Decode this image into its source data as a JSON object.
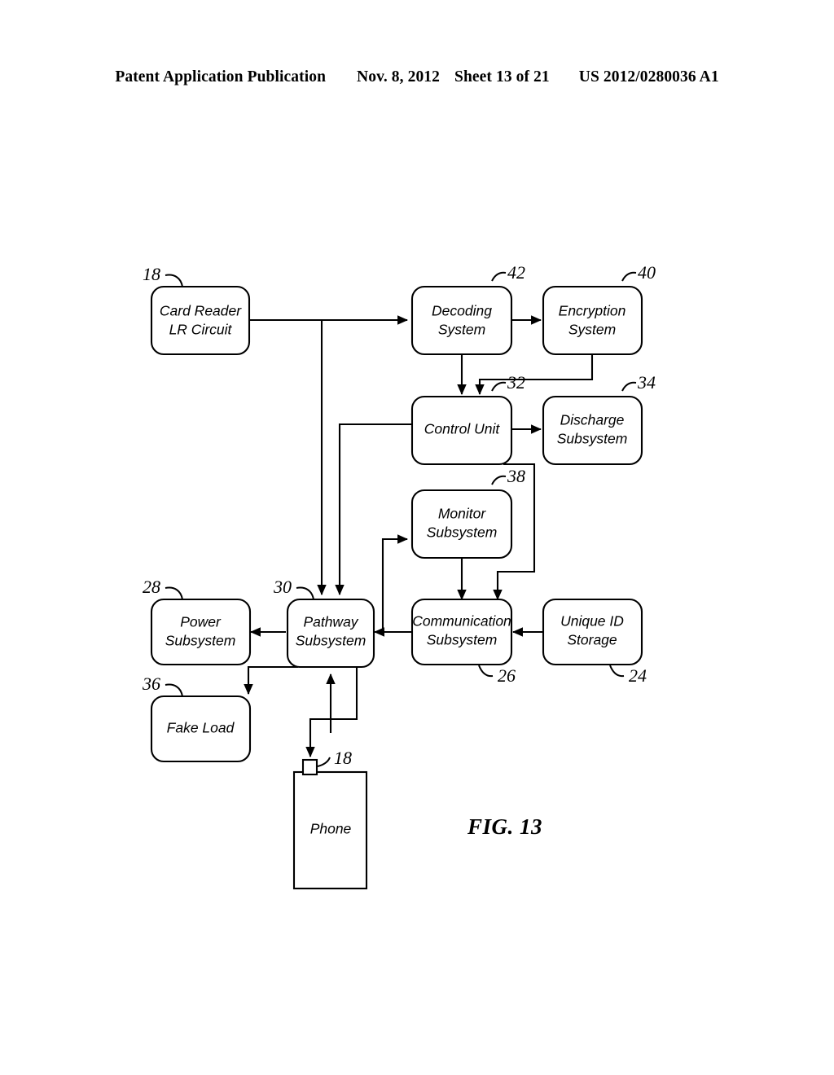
{
  "header": {
    "title": "Patent Application Publication",
    "date": "Nov. 8, 2012",
    "sheet": "Sheet 13 of 21",
    "publication_number": "US 2012/0280036 A1"
  },
  "figure": {
    "caption": "FIG. 13",
    "boxes": {
      "card_reader": {
        "line1": "Card Reader",
        "line2": "LR Circuit",
        "ref": "18"
      },
      "decoding": {
        "line1": "Decoding",
        "line2": "System",
        "ref": "42"
      },
      "encryption": {
        "line1": "Encryption",
        "line2": "System",
        "ref": "40"
      },
      "control_unit": {
        "line1": "Control Unit",
        "line2": "",
        "ref": "32"
      },
      "discharge": {
        "line1": "Discharge",
        "line2": "Subsystem",
        "ref": "34"
      },
      "monitor": {
        "line1": "Monitor",
        "line2": "Subsystem",
        "ref": "38"
      },
      "power": {
        "line1": "Power",
        "line2": "Subsystem",
        "ref": "28"
      },
      "pathway": {
        "line1": "Pathway",
        "line2": "Subsystem",
        "ref": "30"
      },
      "communication": {
        "line1": "Communication",
        "line2": "Subsystem",
        "ref": "26"
      },
      "unique_id": {
        "line1": "Unique ID",
        "line2": "Storage",
        "ref": "24"
      },
      "fake_load": {
        "line1": "Fake Load",
        "line2": "",
        "ref": "36"
      },
      "phone": {
        "line1": "Phone",
        "line2": "",
        "ref": "18"
      }
    }
  },
  "colors": {
    "ink": "#000000",
    "paper": "#ffffff"
  }
}
